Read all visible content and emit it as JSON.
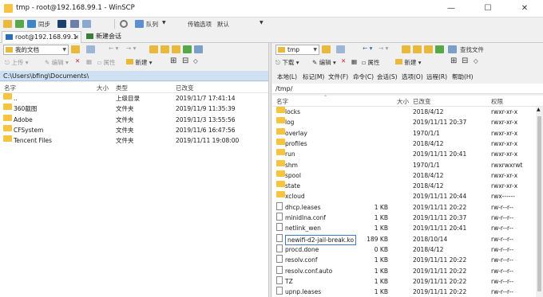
{
  "window": {
    "title": "tmp - root@192.168.99.1 - WinSCP"
  },
  "toolbar": {
    "sync_label": "同步",
    "queue_label": "队列",
    "transfer_label": "传输选项",
    "transfer_value": "默认"
  },
  "tabs": [
    {
      "label": "root@192.168.99.1"
    },
    {
      "label": "新建会话"
    }
  ],
  "left": {
    "location": "我的文档",
    "upload_label": "上传",
    "edit_label": "编辑",
    "props_label": "属性",
    "new_label": "新建",
    "path": "C:\\Users\\bfing\\Documents\\",
    "columns": {
      "name": "名字",
      "size": "大小",
      "type": "类型",
      "changed": "已改变"
    },
    "rows": [
      {
        "name": "..",
        "size": "",
        "type": "上级目录",
        "changed": "2019/11/7   17:41:14",
        "icon": "up-folder-icon"
      },
      {
        "name": "360截图",
        "size": "",
        "type": "文件夹",
        "changed": "2019/11/9   11:35:39",
        "icon": "folder-icon"
      },
      {
        "name": "Adobe",
        "size": "",
        "type": "文件夹",
        "changed": "2019/11/3   13:55:56",
        "icon": "folder-icon"
      },
      {
        "name": "CFSystem",
        "size": "",
        "type": "文件夹",
        "changed": "2019/11/6   16:47:56",
        "icon": "folder-icon"
      },
      {
        "name": "Tencent Files",
        "size": "",
        "type": "文件夹",
        "changed": "2019/11/11  19:08:00",
        "icon": "folder-icon"
      }
    ]
  },
  "right": {
    "location": "tmp",
    "find_label": "查找文件",
    "download_label": "下载",
    "edit_label": "编辑",
    "props_label": "属性",
    "new_label": "新建",
    "menu": [
      "本地(L)",
      "标记(M)",
      "文件(F)",
      "命令(C)",
      "会话(S)",
      "选项(O)",
      "远程(R)",
      "帮助(H)"
    ],
    "path": "/tmp/",
    "columns": {
      "name": "名字",
      "size": "大小",
      "changed": "已改变",
      "rights": "权限"
    },
    "rows": [
      {
        "name": "locks",
        "size": "",
        "changed": "2018/4/12",
        "rights": "rwxr-xr-x",
        "icon": "folder-icon"
      },
      {
        "name": "log",
        "size": "",
        "changed": "2019/11/11 20:37",
        "rights": "rwxr-xr-x",
        "icon": "folder-icon"
      },
      {
        "name": "overlay",
        "size": "",
        "changed": "1970/1/1",
        "rights": "rwxr-xr-x",
        "icon": "folder-icon"
      },
      {
        "name": "profiles",
        "size": "",
        "changed": "2018/4/12",
        "rights": "rwxr-xr-x",
        "icon": "folder-icon"
      },
      {
        "name": "run",
        "size": "",
        "changed": "2019/11/11 20:41",
        "rights": "rwxr-xr-x",
        "icon": "folder-icon"
      },
      {
        "name": "shm",
        "size": "",
        "changed": "1970/1/1",
        "rights": "rwxrwxrwt",
        "icon": "folder-icon"
      },
      {
        "name": "spool",
        "size": "",
        "changed": "2018/4/12",
        "rights": "rwxr-xr-x",
        "icon": "folder-icon"
      },
      {
        "name": "state",
        "size": "",
        "changed": "2018/4/12",
        "rights": "rwxr-xr-x",
        "icon": "folder-icon"
      },
      {
        "name": "xcloud",
        "size": "",
        "changed": "2019/11/11 20:44",
        "rights": "rwx------",
        "icon": "folder-icon"
      },
      {
        "name": "dhcp.leases",
        "size": "1 KB",
        "changed": "2019/11/11 20:22",
        "rights": "rw-r--r--",
        "icon": "file-icon"
      },
      {
        "name": "minidlna.conf",
        "size": "1 KB",
        "changed": "2019/11/11 20:37",
        "rights": "rw-r--r--",
        "icon": "file-icon"
      },
      {
        "name": "netlink_wen",
        "size": "1 KB",
        "changed": "2019/11/11 20:41",
        "rights": "rw-r--r--",
        "icon": "file-icon"
      },
      {
        "name": "newifi-d2-jail-break.ko",
        "size": "189 KB",
        "changed": "2018/10/14",
        "rights": "rw-r--r--",
        "icon": "file-icon",
        "selected": true
      },
      {
        "name": "procd.done",
        "size": "0 KB",
        "changed": "2018/4/12",
        "rights": "rw-r--r--",
        "icon": "file-icon"
      },
      {
        "name": "resolv.conf",
        "size": "1 KB",
        "changed": "2019/11/11 20:22",
        "rights": "rw-r--r--",
        "icon": "file-icon"
      },
      {
        "name": "resolv.conf.auto",
        "size": "1 KB",
        "changed": "2019/11/11 20:22",
        "rights": "rw-r--r--",
        "icon": "file-icon"
      },
      {
        "name": "TZ",
        "size": "1 KB",
        "changed": "2019/11/11 20:22",
        "rights": "rw-r--r--",
        "icon": "file-icon"
      },
      {
        "name": "upnp.leases",
        "size": "1 KB",
        "changed": "2019/11/11 20:22",
        "rights": "rw-r--r--",
        "icon": "file-icon"
      }
    ]
  }
}
